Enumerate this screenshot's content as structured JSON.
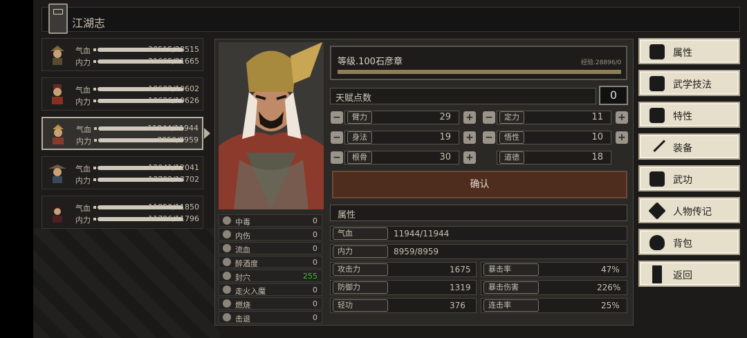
{
  "header": {
    "title": "江湖志"
  },
  "characters": [
    {
      "hp_label": "气血",
      "hp": "28515/28515",
      "mp_label": "内力",
      "mp": "21665/21665",
      "selected": false
    },
    {
      "hp_label": "气血",
      "hp": "10602/10602",
      "mp_label": "内力",
      "mp": "10626/10626",
      "selected": false
    },
    {
      "hp_label": "气血",
      "hp": "11944/11944",
      "mp_label": "内力",
      "mp": "8959/8959",
      "selected": true
    },
    {
      "hp_label": "气血",
      "hp": "12041/12041",
      "mp_label": "内力",
      "mp": "13702/13702",
      "selected": false
    },
    {
      "hp_label": "气血",
      "hp": "11850/11850",
      "mp_label": "内力",
      "mp": "11796/11796",
      "selected": false
    }
  ],
  "status_effects": [
    {
      "name": "中毒",
      "value": "0"
    },
    {
      "name": "内伤",
      "value": "0"
    },
    {
      "name": "流血",
      "value": "0"
    },
    {
      "name": "醉酒度",
      "value": "0"
    },
    {
      "name": "封穴",
      "value": "255",
      "color": "#3fbf2f"
    },
    {
      "name": "走火入魔",
      "value": "0"
    },
    {
      "name": "燃烧",
      "value": "0"
    },
    {
      "name": "击退",
      "value": "0"
    }
  ],
  "level": {
    "title": "等级.100石彦章",
    "exp": "经验.28896/0"
  },
  "talent": {
    "label": "天赋点数",
    "points": "0"
  },
  "stats": [
    {
      "name": "臂力",
      "value": "29"
    },
    {
      "name": "定力",
      "value": "11"
    },
    {
      "name": "身法",
      "value": "19"
    },
    {
      "name": "悟性",
      "value": "10"
    },
    {
      "name": "根骨",
      "value": "30"
    },
    {
      "name": "道德",
      "value": "18"
    }
  ],
  "confirm_label": "确认",
  "attributes": {
    "section_label": "属性",
    "hp_label": "气血",
    "hp": "11944/11944",
    "mp_label": "内力",
    "mp": "8959/8959",
    "atk_label": "攻击力",
    "atk": "1675",
    "crit_rate_label": "暴击率",
    "crit_rate": "47%",
    "def_label": "防御力",
    "def": "1319",
    "crit_dmg_label": "暴击伤害",
    "crit_dmg": "226%",
    "qinggong_label": "轻功",
    "qinggong": "376",
    "combo_label": "连击率",
    "combo": "25%"
  },
  "menu": [
    {
      "label": "属性",
      "icon": "attributes-icon"
    },
    {
      "label": "武学技法",
      "icon": "skills-icon"
    },
    {
      "label": "特性",
      "icon": "traits-icon"
    },
    {
      "label": "装备",
      "icon": "sword-icon"
    },
    {
      "label": "武功",
      "icon": "book-icon"
    },
    {
      "label": "人物传记",
      "icon": "biography-icon"
    },
    {
      "label": "背包",
      "icon": "bag-icon"
    },
    {
      "label": "返回",
      "icon": "door-icon"
    }
  ],
  "colors": {
    "accent_green": "#3fbf2f",
    "confirm_bg": "#4e2c1e",
    "menu_bg": "#e5dfcc"
  }
}
